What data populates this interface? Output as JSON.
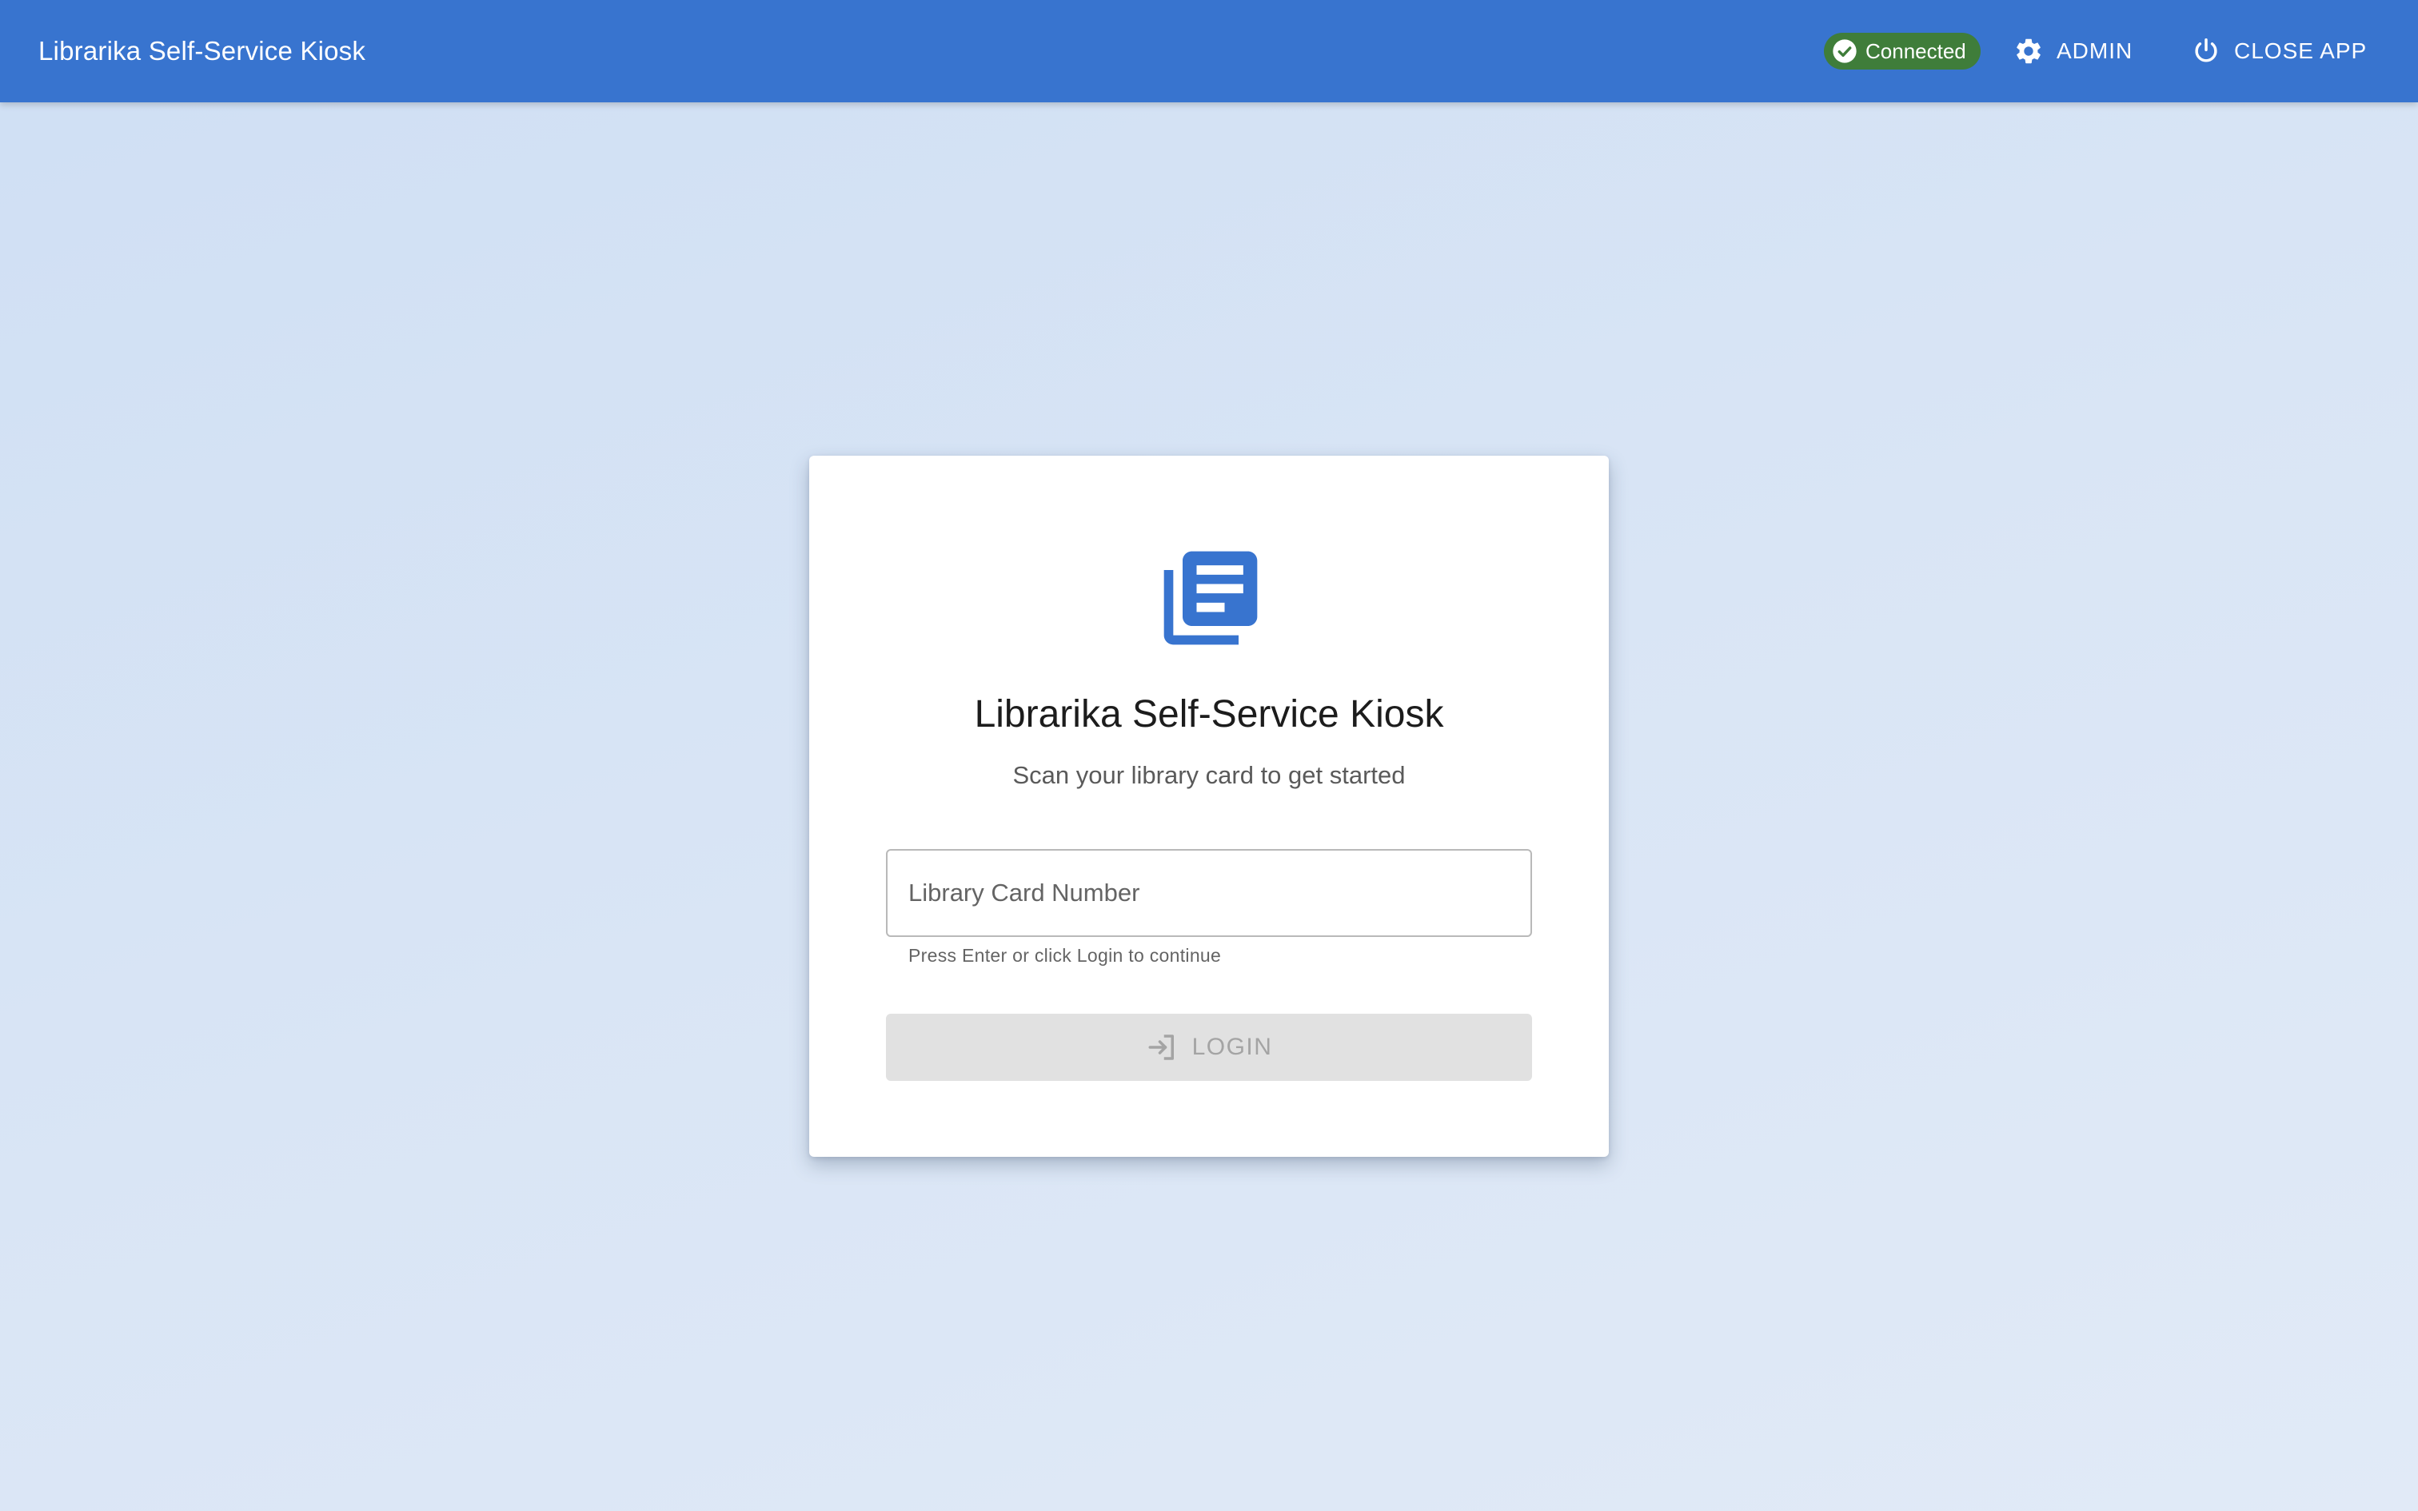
{
  "appbar": {
    "title": "Librarika Self-Service Kiosk",
    "status": {
      "label": "Connected",
      "icon": "check-circle-icon",
      "color": "#3f7d3a"
    },
    "admin_label": "Admin",
    "close_label": "Close App",
    "background": "#3874cf"
  },
  "login_card": {
    "logo_icon": "library-books-icon",
    "logo_color": "#3874cf",
    "title": "Librarika Self-Service Kiosk",
    "subtitle": "Scan your library card to get started",
    "card_input": {
      "value": "",
      "placeholder": "Library Card Number"
    },
    "helper_text": "Press Enter or click Login to continue",
    "login_button": {
      "label": "Login",
      "icon": "login-icon",
      "disabled": true
    }
  }
}
